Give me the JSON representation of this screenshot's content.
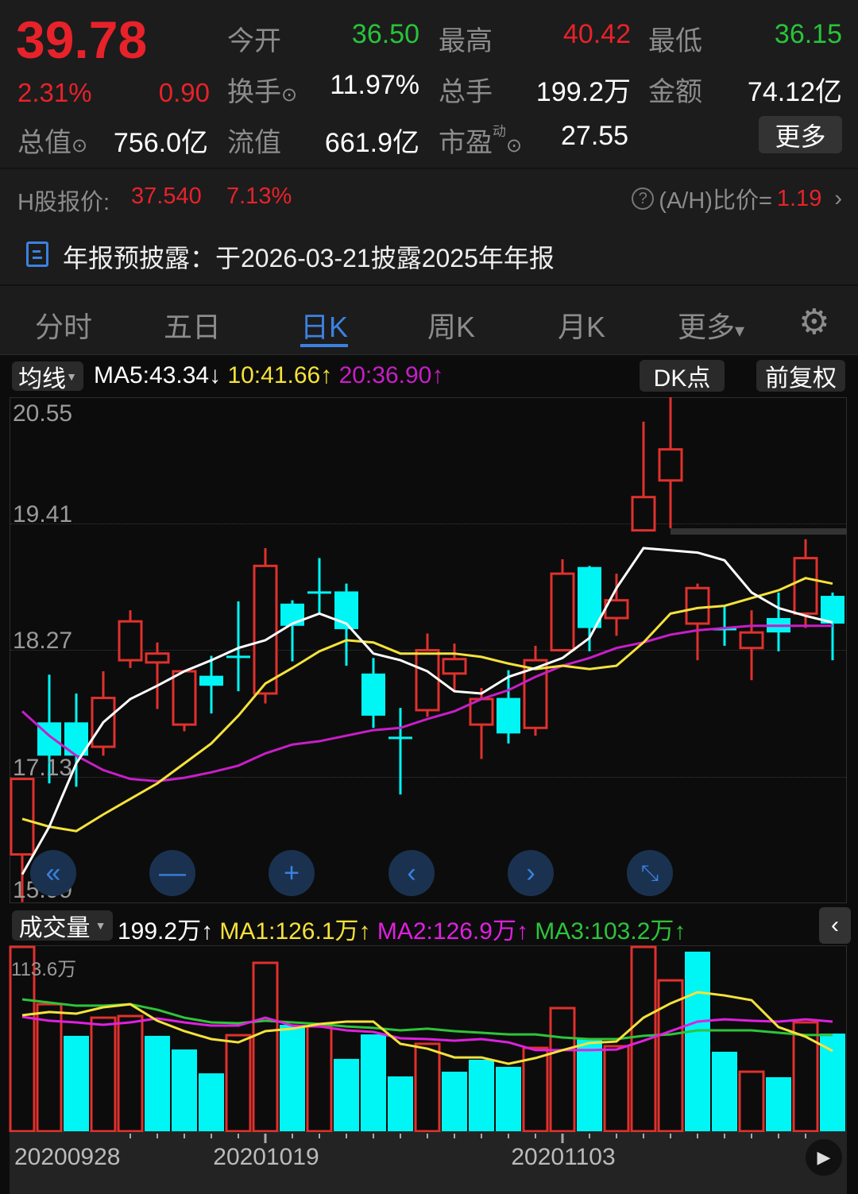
{
  "quote": {
    "price": "39.78",
    "change_pct": "2.31%",
    "change": "0.90",
    "rows": [
      [
        {
          "label": "今开",
          "value": "36.50",
          "color": "green"
        },
        {
          "label": "最高",
          "value": "40.42",
          "color": "red"
        },
        {
          "label": "最低",
          "value": "36.15",
          "color": "green"
        }
      ],
      [
        {
          "label": "换手",
          "value": "11.97%",
          "color": "white"
        },
        {
          "label": "总手",
          "value": "199.2万",
          "color": "white"
        },
        {
          "label": "金额",
          "value": "74.12亿",
          "color": "white"
        }
      ]
    ],
    "total_value_label": "总值",
    "total_value": "756.0亿",
    "float_value_label": "流值",
    "float_value": "661.9亿",
    "pe_label": "市盈",
    "pe_sup": "动",
    "pe_value": "27.55",
    "more_button": "更多"
  },
  "hshare": {
    "label": "H股报价:",
    "price": "37.540",
    "pct": "7.13%",
    "ratio_label": "(A/H)比价=",
    "ratio": "1.19"
  },
  "notice": {
    "text": "年报预披露：于2026-03-21披露2025年年报",
    "icon": "document-icon"
  },
  "tabs": [
    {
      "label": "分时"
    },
    {
      "label": "五日"
    },
    {
      "label": "日K",
      "active": true
    },
    {
      "label": "周K"
    },
    {
      "label": "月K"
    },
    {
      "label": "更多"
    }
  ],
  "ma_bar": {
    "selector": "均线",
    "ma5": "MA5:43.34",
    "ma5_arrow": "↓",
    "ma10": "10:41.66",
    "ma10_arrow": "↑",
    "ma20": "20:36.90",
    "ma20_arrow": "↑",
    "dk_button": "DK点",
    "adjust_button": "前复权"
  },
  "vol_bar": {
    "selector": "成交量",
    "total": "199.2万",
    "total_arrow": "↑",
    "ma1": "MA1:126.1万",
    "ma1_arrow": "↑",
    "ma2": "MA2:126.9万",
    "ma2_arrow": "↑",
    "ma3": "MA3:103.2万",
    "ma3_arrow": "↑"
  },
  "colors": {
    "up": "#e0312c",
    "down": "#00f5f5",
    "ma5": "#ffffff",
    "ma10": "#f5e23a",
    "ma20": "#c81ec8",
    "vma1": "#f5e23a",
    "vma2": "#e020e0",
    "vma3": "#2ec43a",
    "accent": "#3b82e0"
  },
  "chart_data": [
    {
      "type": "candlestick",
      "y_ticks": [
        "20.55",
        "19.41",
        "18.27",
        "17.13",
        "15.99"
      ],
      "ylim": [
        15.99,
        20.55
      ],
      "candles": [
        {
          "o": 16.43,
          "h": 17.11,
          "l": 16.0,
          "c": 17.11,
          "up": true
        },
        {
          "o": 17.62,
          "h": 18.05,
          "l": 17.07,
          "c": 17.32,
          "up": false
        },
        {
          "o": 17.62,
          "h": 17.88,
          "l": 17.04,
          "c": 17.32,
          "up": false
        },
        {
          "o": 17.4,
          "h": 18.08,
          "l": 17.32,
          "c": 17.84,
          "up": true
        },
        {
          "o": 18.18,
          "h": 18.63,
          "l": 18.11,
          "c": 18.53,
          "up": true
        },
        {
          "o": 18.16,
          "h": 18.34,
          "l": 17.74,
          "c": 18.24,
          "up": true
        },
        {
          "o": 17.6,
          "h": 18.08,
          "l": 17.54,
          "c": 18.08,
          "up": true
        },
        {
          "o": 18.04,
          "h": 18.22,
          "l": 17.7,
          "c": 17.95,
          "up": false
        },
        {
          "o": 18.21,
          "h": 18.71,
          "l": 17.9,
          "c": 18.21,
          "up": false
        },
        {
          "o": 17.88,
          "h": 19.19,
          "l": 17.79,
          "c": 19.03,
          "up": true
        },
        {
          "o": 18.69,
          "h": 18.72,
          "l": 18.17,
          "c": 18.49,
          "up": false
        },
        {
          "o": 18.79,
          "h": 19.1,
          "l": 18.61,
          "c": 18.79,
          "up": false
        },
        {
          "o": 18.8,
          "h": 18.87,
          "l": 18.13,
          "c": 18.46,
          "up": false
        },
        {
          "o": 18.06,
          "h": 18.2,
          "l": 17.57,
          "c": 17.68,
          "up": false
        },
        {
          "o": 17.48,
          "h": 17.75,
          "l": 16.97,
          "c": 17.48,
          "up": false
        },
        {
          "o": 17.73,
          "h": 18.42,
          "l": 17.67,
          "c": 18.27,
          "up": true
        },
        {
          "o": 18.06,
          "h": 18.33,
          "l": 17.9,
          "c": 18.19,
          "up": true
        },
        {
          "o": 17.6,
          "h": 17.93,
          "l": 17.29,
          "c": 17.83,
          "up": true
        },
        {
          "o": 17.84,
          "h": 18.09,
          "l": 17.43,
          "c": 17.52,
          "up": false
        },
        {
          "o": 17.57,
          "h": 18.31,
          "l": 17.5,
          "c": 18.18,
          "up": true
        },
        {
          "o": 18.27,
          "h": 19.09,
          "l": 18.26,
          "c": 18.96,
          "up": true
        },
        {
          "o": 19.02,
          "h": 19.03,
          "l": 18.26,
          "c": 18.47,
          "up": false
        },
        {
          "o": 18.56,
          "h": 18.96,
          "l": 18.4,
          "c": 18.72,
          "up": true
        },
        {
          "o": 19.35,
          "h": 20.33,
          "l": 19.35,
          "c": 19.65,
          "up": true
        },
        {
          "o": 19.8,
          "h": 20.55,
          "l": 19.37,
          "c": 20.08,
          "up": true
        },
        {
          "o": 18.51,
          "h": 18.87,
          "l": 18.18,
          "c": 18.83,
          "up": true
        },
        {
          "o": 18.46,
          "h": 18.67,
          "l": 18.31,
          "c": 18.46,
          "up": false
        },
        {
          "o": 18.29,
          "h": 18.63,
          "l": 18.0,
          "c": 18.43,
          "up": true
        },
        {
          "o": 18.56,
          "h": 18.79,
          "l": 18.26,
          "c": 18.43,
          "up": false
        },
        {
          "o": 18.6,
          "h": 19.27,
          "l": 18.47,
          "c": 19.1,
          "up": true
        },
        {
          "o": 18.76,
          "h": 18.79,
          "l": 18.18,
          "c": 18.51,
          "up": false
        }
      ],
      "ma5": [
        16.25,
        16.68,
        17.25,
        17.62,
        17.83,
        17.95,
        18.08,
        18.18,
        18.29,
        18.36,
        18.51,
        18.6,
        18.51,
        18.24,
        18.18,
        18.08,
        17.9,
        17.88,
        18.03,
        18.11,
        18.2,
        18.38,
        18.83,
        19.19,
        19.17,
        19.15,
        19.08,
        18.79,
        18.65,
        18.58,
        18.52
      ],
      "ma10": [
        16.75,
        16.68,
        16.64,
        16.79,
        16.93,
        17.07,
        17.25,
        17.43,
        17.68,
        17.97,
        18.11,
        18.26,
        18.36,
        18.34,
        18.24,
        18.24,
        18.24,
        18.21,
        18.15,
        18.1,
        18.13,
        18.1,
        18.13,
        18.34,
        18.6,
        18.65,
        18.67,
        18.74,
        18.81,
        18.92,
        18.87
      ],
      "ma20": [
        17.72,
        17.5,
        17.32,
        17.19,
        17.11,
        17.09,
        17.12,
        17.17,
        17.23,
        17.34,
        17.42,
        17.45,
        17.5,
        17.55,
        17.57,
        17.65,
        17.72,
        17.83,
        17.91,
        18.03,
        18.13,
        18.2,
        18.29,
        18.34,
        18.41,
        18.45,
        18.47,
        18.49,
        18.49,
        18.49,
        18.49
      ]
    },
    {
      "type": "bar",
      "unit": "万",
      "y_max_label": "113.6万",
      "ylim": [
        0,
        113.6
      ],
      "x_labels": [
        "20200928",
        "20201019",
        "20201103"
      ],
      "volumes": [
        113.6,
        78.3,
        58.8,
        70.0,
        71.0,
        58.8,
        50.4,
        35.7,
        59.2,
        103.8,
        65.6,
        64.6,
        44.6,
        59.7,
        33.8,
        53.9,
        36.7,
        44.1,
        39.7,
        51.4,
        75.9,
        57.3,
        52.4,
        113.6,
        93.0,
        110.7,
        49.0,
        36.7,
        33.3,
        67.1,
        60.2
      ],
      "up": [
        true,
        true,
        false,
        true,
        true,
        false,
        false,
        false,
        true,
        true,
        false,
        true,
        false,
        false,
        false,
        true,
        false,
        false,
        false,
        true,
        true,
        false,
        true,
        true,
        true,
        false,
        false,
        true,
        false,
        true,
        false
      ],
      "ma1": [
        71.5,
        73.5,
        72.5,
        76.4,
        78.3,
        68.1,
        61.7,
        56.8,
        54.8,
        61.7,
        63.2,
        66.1,
        67.6,
        67.6,
        53.9,
        50.9,
        45.5,
        45.5,
        41.6,
        45.1,
        50.0,
        54.4,
        55.3,
        70.0,
        78.8,
        85.7,
        83.7,
        80.8,
        64.2,
        58.3,
        49.5
      ],
      "ma2": [
        70.5,
        68.1,
        67.1,
        65.6,
        67.1,
        69.5,
        67.1,
        65.1,
        65.1,
        70.0,
        65.1,
        64.6,
        62.2,
        61.2,
        57.3,
        56.8,
        55.8,
        56.8,
        54.8,
        50.0,
        50.0,
        50.0,
        50.4,
        55.8,
        61.7,
        67.6,
        69.0,
        68.1,
        67.6,
        69.0,
        67.6
      ],
      "ma3": [
        81.3,
        79.3,
        77.4,
        77.4,
        78.3,
        74.9,
        70.0,
        67.1,
        66.6,
        68.1,
        67.1,
        66.1,
        64.6,
        63.7,
        62.2,
        63.2,
        61.7,
        60.7,
        59.7,
        59.7,
        57.8,
        56.8,
        56.8,
        58.8,
        59.7,
        62.2,
        62.2,
        62.2,
        60.7,
        59.3,
        59.3
      ]
    }
  ]
}
